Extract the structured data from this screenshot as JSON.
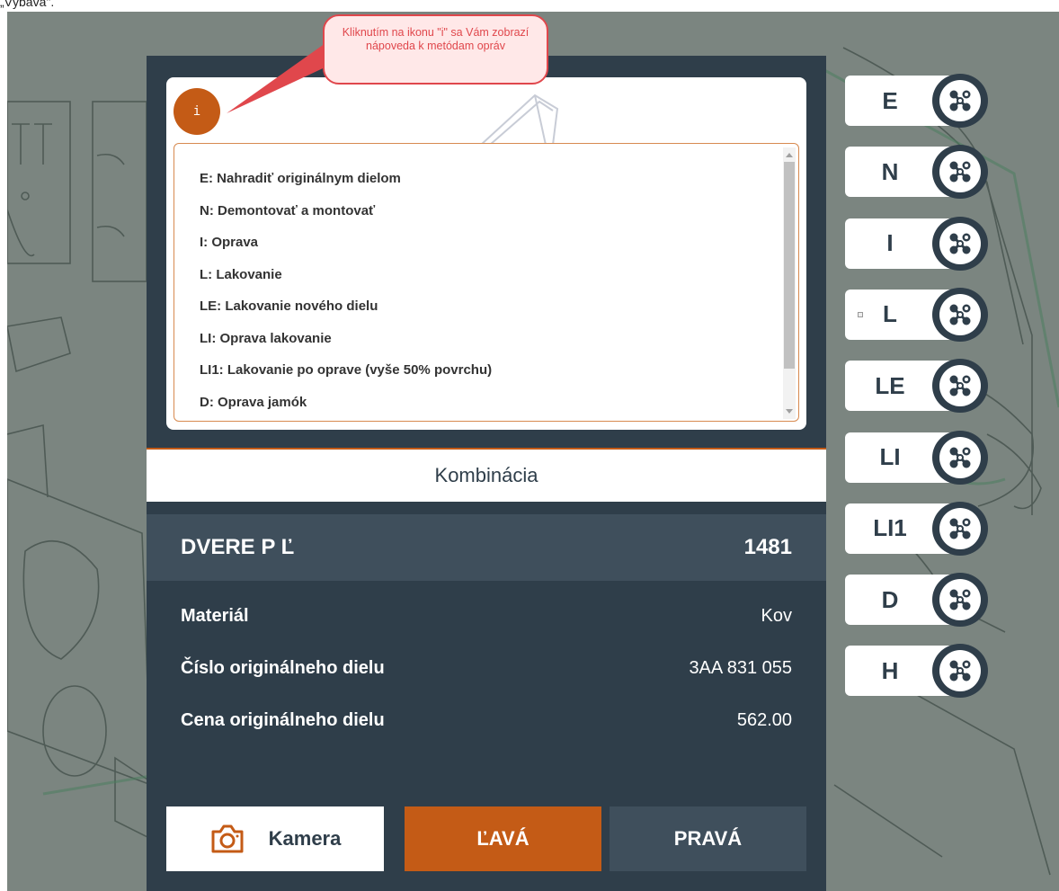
{
  "caption": "„Výbava\".",
  "tooltip": {
    "text": "Kliknutím na ikonu \"i\" sa Vám zobrazí nápoveda k metódam opráv"
  },
  "info_button": {
    "label": "i"
  },
  "legend": [
    "E: Nahradiť originálnym dielom",
    "N: Demontovať a montovať",
    "I: Oprava",
    "L: Lakovanie",
    "LE: Lakovanie nového dielu",
    "LI: Oprava lakovanie",
    "LI1: Lakovanie po oprave (vyše 50% povrchu)",
    "D: Oprava jamók"
  ],
  "combination": {
    "label": "Kombinácia"
  },
  "part": {
    "name": "DVERE P Ľ",
    "code": "1481",
    "rows": [
      {
        "label": "Materiál",
        "value": "Kov"
      },
      {
        "label": "Číslo originálneho dielu",
        "value": "3AA 831 055"
      },
      {
        "label": "Cena originálneho dielu",
        "value": "562.00"
      }
    ]
  },
  "buttons": {
    "camera": "Kamera",
    "left": "ĽAVÁ",
    "right": "PRAVÁ"
  },
  "actions": [
    {
      "label": "E",
      "icon": "combine-icon"
    },
    {
      "label": "N",
      "icon": "combine-icon"
    },
    {
      "label": "I",
      "icon": "combine-icon"
    },
    {
      "label": "L",
      "icon": "combine-icon"
    },
    {
      "label": "LE",
      "icon": "combine-icon"
    },
    {
      "label": "LI",
      "icon": "combine-icon"
    },
    {
      "label": "LI1",
      "icon": "combine-icon"
    },
    {
      "label": "D",
      "icon": "combine-icon"
    },
    {
      "label": "H",
      "icon": "combine-icon"
    }
  ],
  "colors": {
    "accent": "#c45b16",
    "panel": "#2f3e4a",
    "panel_light": "#3f4f5c",
    "tooltip_border": "#e0474c",
    "background": "#7b8580"
  }
}
